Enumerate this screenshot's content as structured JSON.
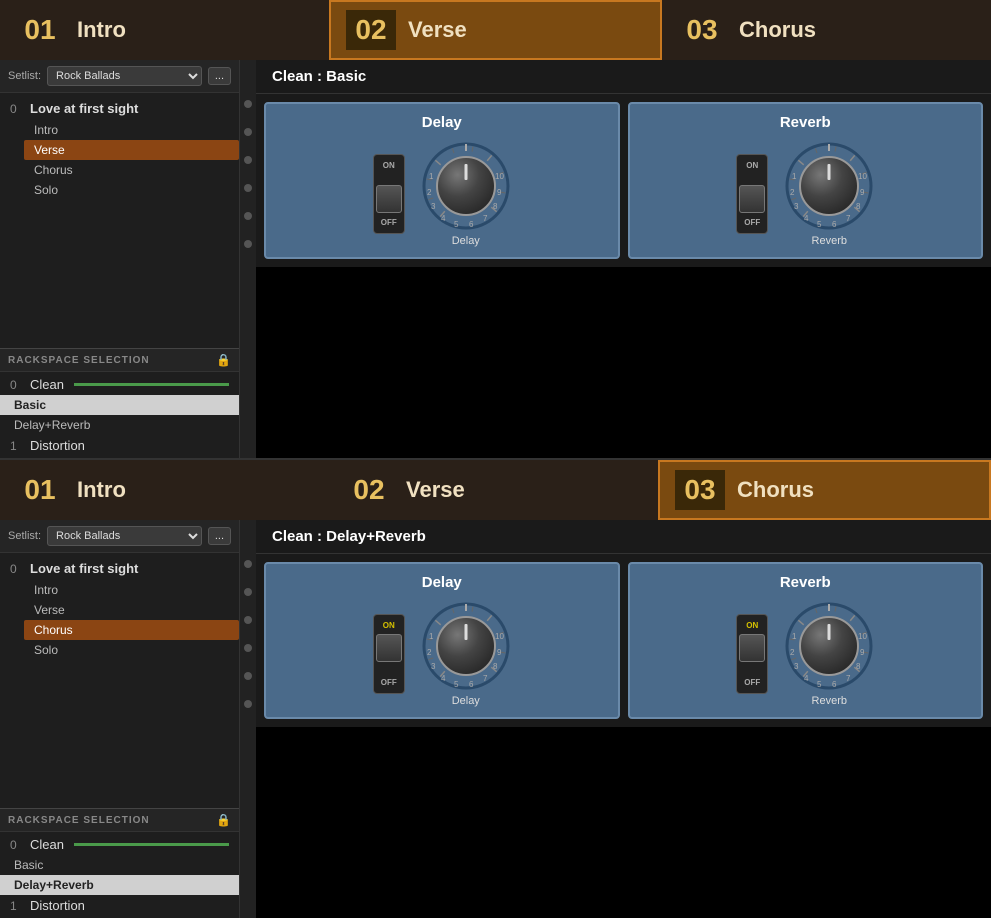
{
  "panel1": {
    "parts": [
      {
        "number": "01",
        "name": "Intro",
        "active": false
      },
      {
        "number": "02",
        "name": "Verse",
        "active": true
      },
      {
        "number": "03",
        "name": "Chorus",
        "active": false
      }
    ],
    "setlist_label": "Setlist:",
    "setlist_value": "Rock Ballads",
    "setlist_more": "...",
    "song_number": "0",
    "song_name": "Love at first sight",
    "song_parts": [
      "Intro",
      "Verse",
      "Chorus",
      "Solo"
    ],
    "active_part": "Verse",
    "rackspace_header": "RACKSPACE SELECTION",
    "rackspace_group_number": "0",
    "rackspace_group_name": "Clean",
    "rackspace_presets": [
      "Basic",
      "Delay+Reverb"
    ],
    "active_preset": "Basic",
    "distortion_number": "1",
    "distortion_name": "Distortion",
    "rack_title": "Clean : Basic",
    "delay_title": "Delay",
    "delay_label": "Delay",
    "reverb_title": "Reverb",
    "reverb_label": "Reverb"
  },
  "panel2": {
    "parts": [
      {
        "number": "01",
        "name": "Intro",
        "active": false
      },
      {
        "number": "02",
        "name": "Verse",
        "active": false
      },
      {
        "number": "03",
        "name": "Chorus",
        "active": true
      }
    ],
    "setlist_label": "Setlist:",
    "setlist_value": "Rock Ballads",
    "setlist_more": "...",
    "song_number": "0",
    "song_name": "Love at first sight",
    "song_parts": [
      "Intro",
      "Verse",
      "Chorus",
      "Solo"
    ],
    "active_part": "Chorus",
    "rackspace_header": "RACKSPACE SELECTION",
    "rackspace_group_number": "0",
    "rackspace_group_name": "Clean",
    "rackspace_presets": [
      "Basic",
      "Delay+Reverb"
    ],
    "active_preset": "Delay+Reverb",
    "distortion_number": "1",
    "distortion_name": "Distortion",
    "rack_title": "Clean : Delay+Reverb",
    "delay_title": "Delay",
    "delay_label": "Delay",
    "reverb_title": "Reverb",
    "reverb_label": "Reverb"
  }
}
